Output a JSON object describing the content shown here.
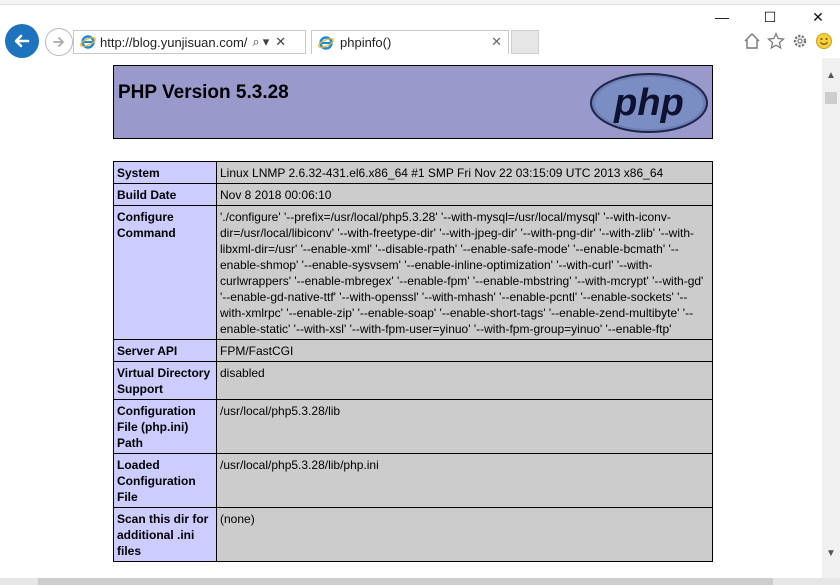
{
  "browser": {
    "address": {
      "url": "http://blog.yunjisuan.com/",
      "search_label": "⌕",
      "dropdown_label": "▾",
      "clear_label": "✕"
    },
    "tabs": [
      {
        "title": "phpinfo()"
      }
    ],
    "window_controls": {
      "minimize": "—",
      "maximize": "☐",
      "close": "✕"
    },
    "icons": [
      "back-arrow-icon",
      "forward-arrow-icon",
      "ie-icon",
      "home-icon",
      "star-icon",
      "gear-icon",
      "smiley-icon"
    ]
  },
  "page": {
    "title": "PHP Version 5.3.28",
    "logo_text": "php",
    "rows": [
      {
        "label": "System",
        "value": "Linux LNMP 2.6.32-431.el6.x86_64 #1 SMP Fri Nov 22 03:15:09 UTC 2013 x86_64"
      },
      {
        "label": "Build Date",
        "value": "Nov 8 2018 00:06:10"
      },
      {
        "label": "Configure Command",
        "value": "'./configure' '--prefix=/usr/local/php5.3.28' '--with-mysql=/usr/local/mysql' '--with-iconv-dir=/usr/local/libiconv' '--with-freetype-dir' '--with-jpeg-dir' '--with-png-dir' '--with-zlib' '--with-libxml-dir=/usr' '--enable-xml' '--disable-rpath' '--enable-safe-mode' '--enable-bcmath' '--enable-shmop' '--enable-sysvsem' '--enable-inline-optimization' '--with-curl' '--with-curlwrappers' '--enable-mbregex' '--enable-fpm' '--enable-mbstring' '--with-mcrypt' '--with-gd' '--enable-gd-native-ttf' '--with-openssl' '--with-mhash' '--enable-pcntl' '--enable-sockets' '--with-xmlrpc' '--enable-zip' '--enable-soap' '--enable-short-tags' '--enable-zend-multibyte' '--enable-static' '--with-xsl' '--with-fpm-user=yinuo' '--with-fpm-group=yinuo' '--enable-ftp'"
      },
      {
        "label": "Server API",
        "value": "FPM/FastCGI"
      },
      {
        "label": "Virtual Directory Support",
        "value": "disabled"
      },
      {
        "label": "Configuration File (php.ini) Path",
        "value": "/usr/local/php5.3.28/lib"
      },
      {
        "label": "Loaded Configuration File",
        "value": "/usr/local/php5.3.28/lib/php.ini"
      },
      {
        "label": "Scan this dir for additional .ini files",
        "value": "(none)"
      }
    ]
  },
  "colors": {
    "header_bg": "#9999cc",
    "label_bg": "#ccccff",
    "value_bg": "#cccccc",
    "back_button": "#1e73be"
  }
}
